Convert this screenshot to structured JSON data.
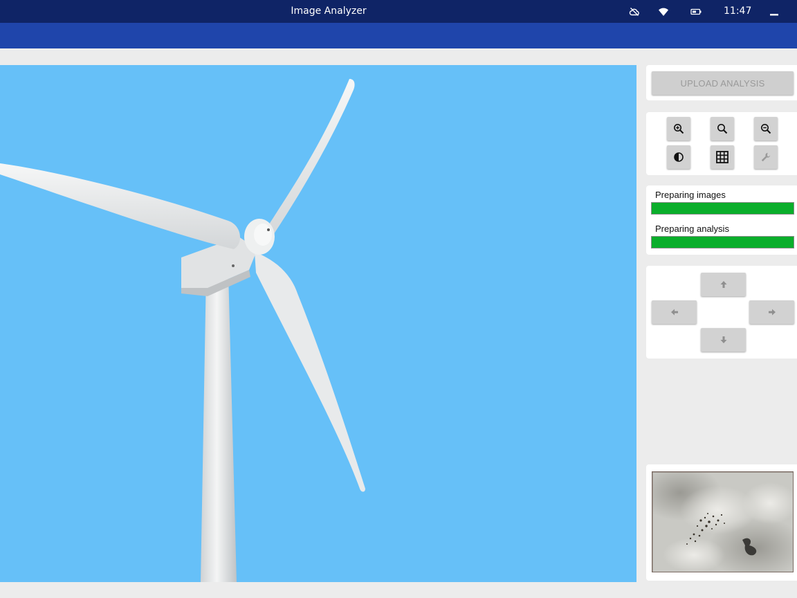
{
  "window": {
    "title": "Image Analyzer",
    "clock": "11:47",
    "tray_icons": [
      "cloud-off-icon",
      "wifi-icon",
      "battery-icon",
      "minimize-icon"
    ]
  },
  "colors": {
    "titlebar": "#0f2466",
    "appbar": "#1f45ab",
    "viewer_bg": "#66c0f8",
    "progress": "#0aae2b"
  },
  "toolbar": {
    "upload_label": "UPLOAD ANALYSIS",
    "tools": [
      "zoom-in-icon",
      "zoom-reset-icon",
      "zoom-out-icon",
      "contrast-icon",
      "grid-icon",
      "wrench-icon"
    ]
  },
  "progress": [
    {
      "label": "Preparing images",
      "value": 100
    },
    {
      "label": "Preparing analysis",
      "value": 100
    }
  ],
  "navigation": [
    "arrow-up-icon",
    "arrow-left-icon",
    "arrow-right-icon",
    "arrow-down-icon"
  ]
}
